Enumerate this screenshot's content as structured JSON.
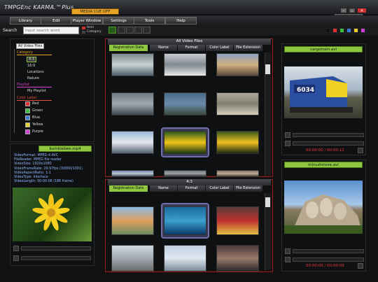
{
  "window": {
    "title": "TMPGEnc KARMA.™Plus",
    "mode": "MEDIA CUE OFF"
  },
  "menu": [
    "Library",
    "Edit",
    "Player Window",
    "Settings",
    "Tools",
    "Help"
  ],
  "search": {
    "label": "Search",
    "placeholder": "Input search word",
    "item_label": "Item",
    "category_label": "Category"
  },
  "colors": {
    "accent": "#8ec73f",
    "mode_badge": "#e8a327",
    "tree_category": "#e8a327",
    "tree_playlist": "#d045d0",
    "tree_colorlabel": "#e0503a"
  },
  "color_swatches": [
    "#111111",
    "#e03030",
    "#3ac040",
    "#3a7ad8",
    "#e8d030",
    "#d040d0"
  ],
  "tree": {
    "root": "All Video Files",
    "category": "Category",
    "category_items": [
      "4:3",
      "16:9",
      "Locations",
      "Nature"
    ],
    "playlist": "Playlist",
    "playlist_items": [
      "My Playlist"
    ],
    "color_label": "Color Label",
    "color_items": [
      {
        "label": "Red",
        "color": "#e03030"
      },
      {
        "label": "Green",
        "color": "#3ac040"
      },
      {
        "label": "Blue",
        "color": "#3a7ad8"
      },
      {
        "label": "Yellow",
        "color": "#e8d030"
      },
      {
        "label": "Purple",
        "color": "#d040d0"
      }
    ]
  },
  "left_player": {
    "file": "bumblebee.mp4",
    "info": [
      "VideoFormat: MPEG-4 AVC",
      "FileReader: MPEG file reader",
      "VideoSize: 1920x1080",
      "VideoFrameRate: 29.97fps (30000/1001)",
      "VideoAspectRatio: 1:1",
      "VideoType: Interlace",
      "VideoLength: 00:00:06 (186 frame)"
    ]
  },
  "browser_top": {
    "title": "All Video Files",
    "columns": [
      "Registration Date",
      "Name",
      "Format",
      "Color Label",
      "File Extension"
    ]
  },
  "browser_bottom": {
    "title": "4:3",
    "columns": [
      "Registration Date",
      "Name",
      "Format",
      "Color Label",
      "File Extension"
    ]
  },
  "right_top": {
    "file": "cargotrain.avi",
    "timecode": "00:00:00 / 00:00:11",
    "train_number": "6034"
  },
  "right_bottom": {
    "file": "mtrushmore.avi",
    "timecode": "00:00:00 / 00:00:09"
  }
}
